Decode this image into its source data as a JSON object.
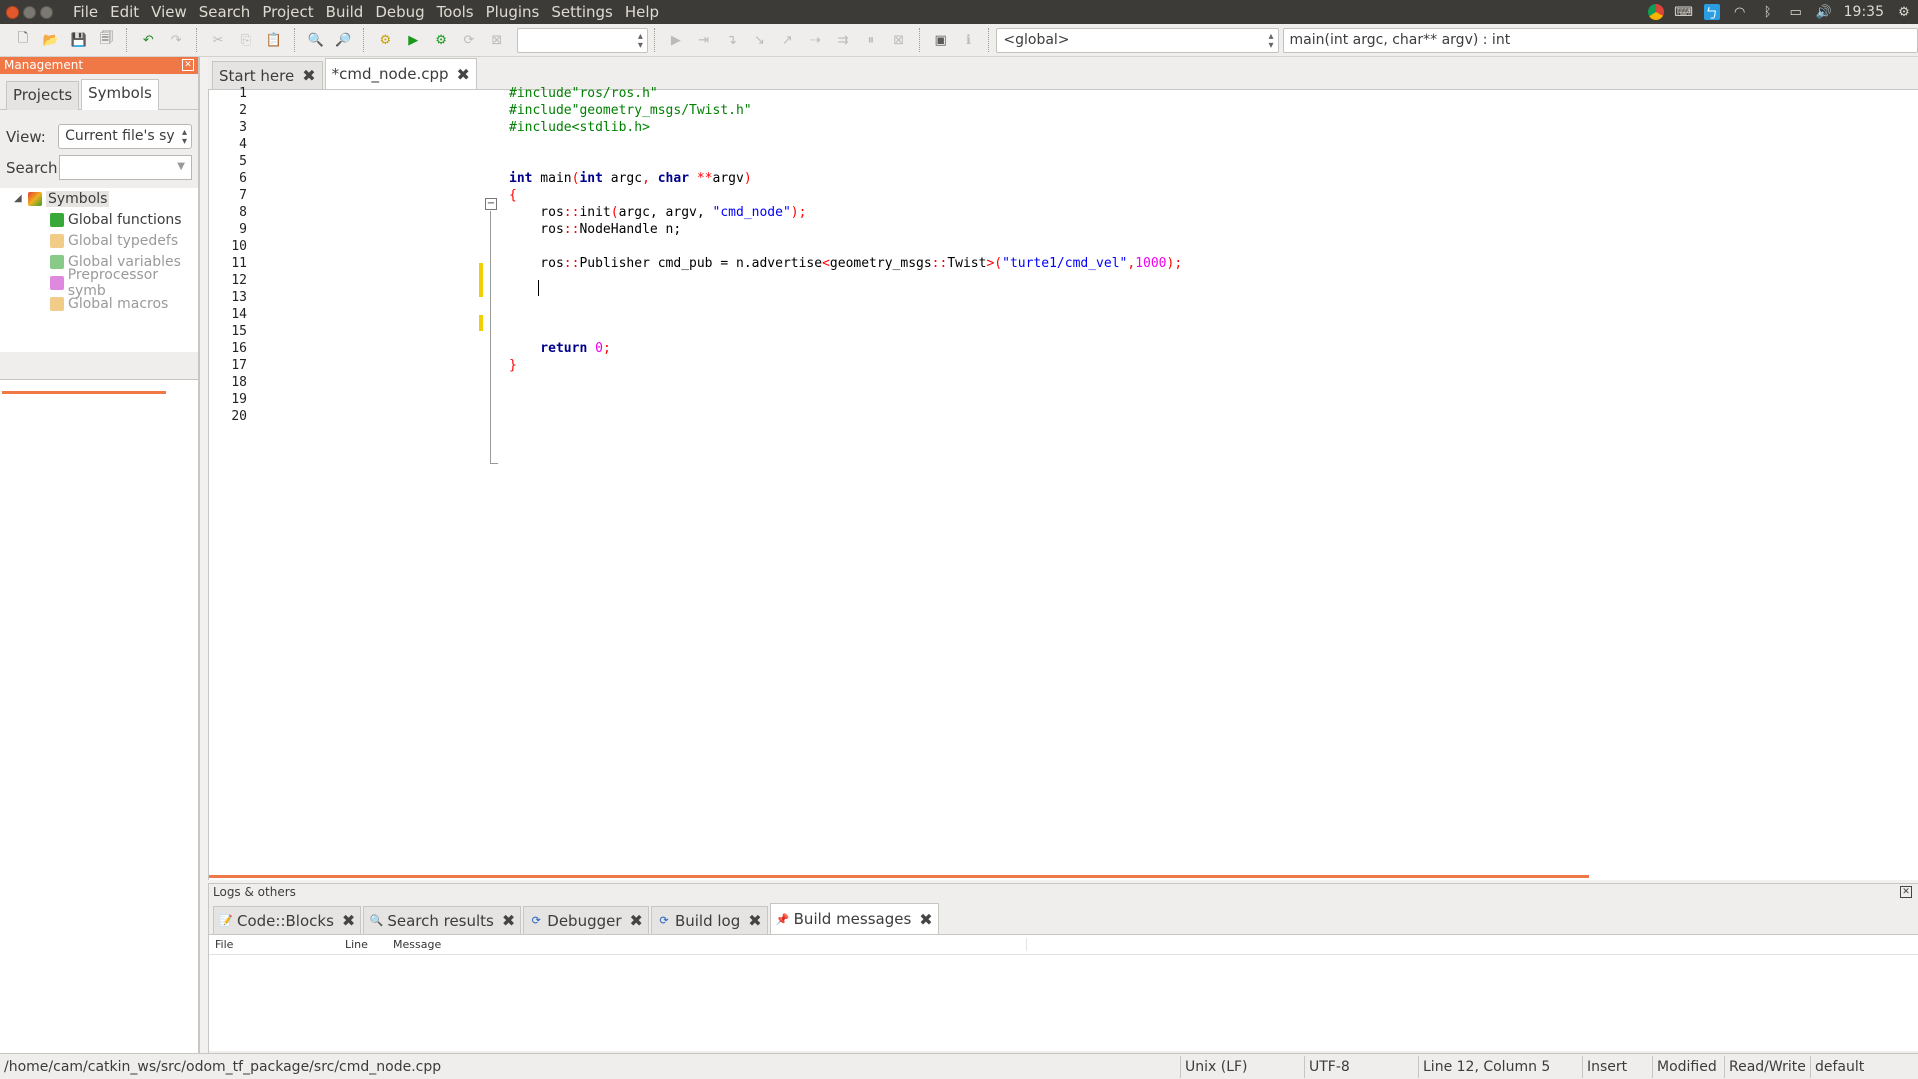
{
  "menu": [
    "File",
    "Edit",
    "View",
    "Search",
    "Project",
    "Build",
    "Debug",
    "Tools",
    "Plugins",
    "Settings",
    "Help"
  ],
  "tray": {
    "clock": "19:35"
  },
  "toolbar": {
    "scope_combo": "<global>",
    "function_combo": "main(int argc, char** argv) : int"
  },
  "management": {
    "title": "Management",
    "tabs": [
      "Projects",
      "Symbols"
    ],
    "view_label": "View:",
    "view_value": "Current file's sy",
    "search_label": "Search:",
    "search_value": "",
    "tree": {
      "root": "Symbols",
      "children": [
        "Global functions",
        "Global typedefs",
        "Global variables",
        "Preprocessor symb",
        "Global macros"
      ]
    }
  },
  "editor": {
    "tabs": [
      "Start here",
      "*cmd_node.cpp"
    ],
    "line_numbers": [
      "1",
      "2",
      "3",
      "4",
      "5",
      "6",
      "7",
      "8",
      "9",
      "10",
      "11",
      "12",
      "13",
      "14",
      "15",
      "16",
      "17",
      "18",
      "19",
      "20"
    ],
    "code": {
      "l1a": "#include",
      "l1b": "\"ros/ros.h\"",
      "l2a": "#include",
      "l2b": "\"geometry_msgs/Twist.h\"",
      "l3a": "#include",
      "l3b": "<stdlib.h>",
      "l6_int": "int",
      "l6_main": " main",
      "l6_p1": "(",
      "l6_int2": "int",
      "l6_argc": " argc",
      "l6_comma": ",",
      "l6_char": " char",
      "l6_stars": " **",
      "l6_argv": "argv",
      "l6_p2": ")",
      "l7": "{",
      "l8_ros": "    ros",
      "l8_sep": "::",
      "l8_init": "init",
      "l8_p1": "(",
      "l8_args": "argc, argv, ",
      "l8_str": "\"cmd_node\"",
      "l8_p2": ");",
      "l9_ros": "    ros",
      "l9_sep": "::",
      "l9_rest": "NodeHandle n;",
      "l11_ros": "    ros",
      "l11_sep": "::",
      "l11_a": "Publisher cmd_pub = n.advertise",
      "l11_lt": "<",
      "l11_geo": "geometry_msgs",
      "l11_sep2": "::",
      "l11_tw": "Twist",
      "l11_gt": ">(",
      "l11_str": "\"turte1/cmd_vel\"",
      "l11_c": ",",
      "l11_num": "1000",
      "l11_end": ");",
      "l16_ret": "    return",
      "l16_num": " 0",
      "l16_end": ";",
      "l17": "}"
    }
  },
  "logs": {
    "title": "Logs & others",
    "tabs": [
      "Code::Blocks",
      "Search results",
      "Debugger",
      "Build log",
      "Build messages"
    ],
    "columns": [
      "File",
      "Line",
      "Message"
    ]
  },
  "status": {
    "path": "/home/cam/catkin_ws/src/odom_tf_package/src/cmd_node.cpp",
    "eol": "Unix (LF)",
    "encoding": "UTF-8",
    "position": "Line 12, Column 5",
    "mode": "Insert",
    "modified": "Modified",
    "access": "Read/Write",
    "lang": "default"
  }
}
